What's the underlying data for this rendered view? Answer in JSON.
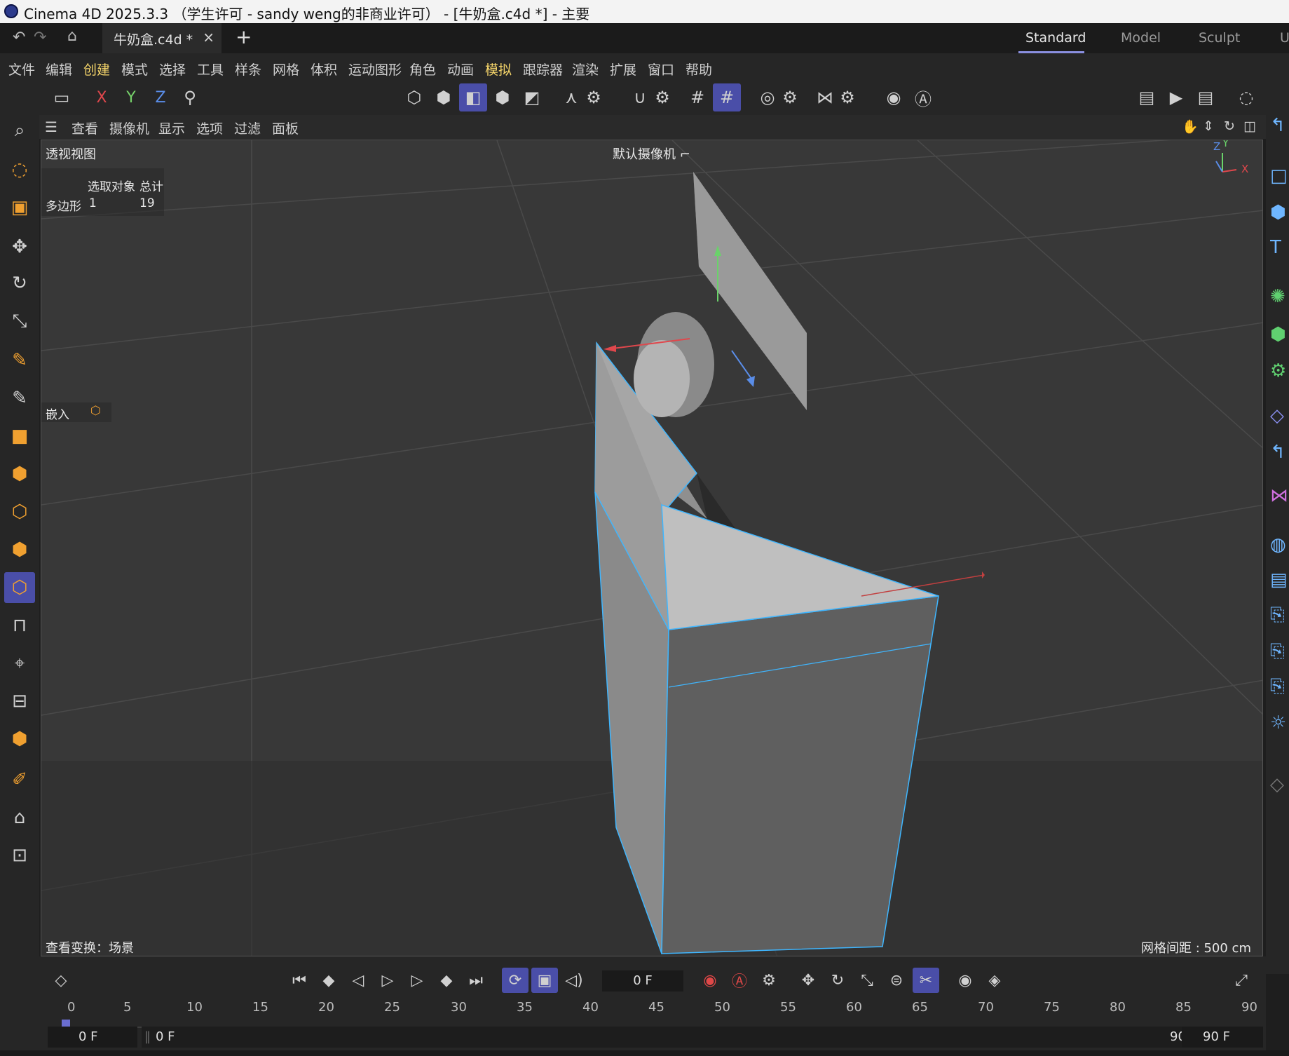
{
  "window": {
    "title": "Cinema 4D 2025.3.3 （学生许可 - sandy weng的非商业许可） - [牛奶盒.c4d *] - 主要"
  },
  "tabs": {
    "active_file": "牛奶盒.c4d *",
    "close": "×",
    "add": "+"
  },
  "layouts": [
    "Standard",
    "Model",
    "Sculpt",
    "U"
  ],
  "menu": [
    "文件",
    "编辑",
    "创建",
    "模式",
    "选择",
    "工具",
    "样条",
    "网格",
    "体积",
    "运动图形",
    "角色",
    "动画",
    "模拟",
    "跟踪器",
    "渲染",
    "扩展",
    "窗口",
    "帮助"
  ],
  "toolbar": {
    "x": "X",
    "y": "Y",
    "z": "Z"
  },
  "viewport_menu": [
    "查看",
    "摄像机",
    "显示",
    "选项",
    "过滤",
    "面板"
  ],
  "viewport": {
    "name": "透视视图",
    "camera": "默认摄像机",
    "hud": {
      "col_selected": "选取对象",
      "col_total": "总计",
      "row_label": "多边形",
      "selected": "1",
      "total": "19"
    },
    "embed": "嵌入",
    "view_transform": "查看变换：场景",
    "grid_spacing": "网格间距 : 500 cm",
    "axis": {
      "y": "Y",
      "z": "Z",
      "x": "X"
    }
  },
  "timeline": {
    "current_frame": "0 F",
    "ticks": [
      "0",
      "5",
      "10",
      "15",
      "20",
      "25",
      "30",
      "35",
      "40",
      "45",
      "50",
      "55",
      "60",
      "65",
      "70",
      "75",
      "80",
      "85",
      "90"
    ],
    "range_start": "0 F",
    "range_min": "0 F",
    "range_max": "90 F",
    "range_end": "90 F"
  },
  "colors": {
    "accent": "#4a4ea8",
    "selection_edge": "#3fb6ff",
    "x_axis": "#e0474c",
    "y_axis": "#76d16a",
    "z_axis": "#5a8de8",
    "highlight_menu": "#f5d56a"
  }
}
